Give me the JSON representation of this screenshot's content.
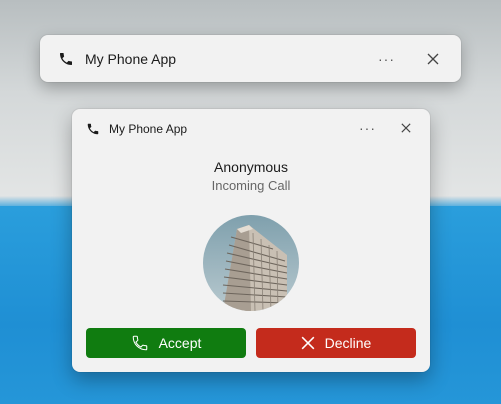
{
  "colors": {
    "accept": "#107c10",
    "decline": "#c42b1c",
    "toast_bg": "#f2f2f2"
  },
  "collapsed_toast": {
    "app_name": "My Phone App",
    "icons": [
      "phone-icon",
      "more-icon",
      "close-icon"
    ]
  },
  "call_toast": {
    "app_name": "My Phone App",
    "caller_name": "Anonymous",
    "status": "Incoming Call",
    "accept_label": "Accept",
    "decline_label": "Decline",
    "icons": [
      "phone-icon",
      "more-icon",
      "close-icon",
      "phone-icon",
      "x-icon"
    ]
  }
}
